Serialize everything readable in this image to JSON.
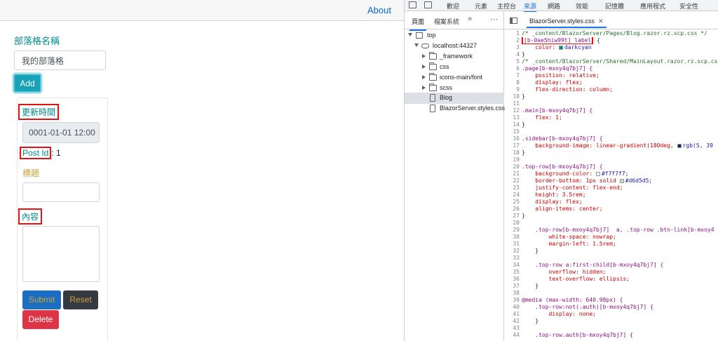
{
  "app": {
    "top_link": "About",
    "blog_name_label": "部落格名稱",
    "blog_name_value": "我的部落格",
    "add_label": "Add",
    "updated_label": "更新時間",
    "updated_value": "0001-01-01 12:00",
    "post_id_label": "Post Id",
    "post_id_value": ": 1",
    "title_label": "標題",
    "content_label": "內容",
    "submit_label": "Submit",
    "reset_label": "Reset",
    "delete_label": "Delete"
  },
  "devtools": {
    "tabs": [
      "歡迎",
      "元素",
      "主控台",
      "來源",
      "網路",
      "效能",
      "記憶體",
      "應用程式",
      "安全性"
    ],
    "active_tab": "來源",
    "nav_tabs": [
      "頁面",
      "檔案系統"
    ],
    "nav_more": "»",
    "nav_menu": "⋯",
    "tree": [
      {
        "label": "top",
        "icon": "frame-icon",
        "expanded": true
      },
      {
        "label": "localhost:44327",
        "icon": "cloud-icon",
        "expanded": true
      },
      {
        "label": "_framework",
        "icon": "folder-icon",
        "expanded": false
      },
      {
        "label": "css",
        "icon": "folder-icon",
        "expanded": false
      },
      {
        "label": "icons-main/font",
        "icon": "folder-icon",
        "expanded": false
      },
      {
        "label": "scss",
        "icon": "folder-icon",
        "expanded": false
      },
      {
        "label": "Blog",
        "icon": "file-icon",
        "selected": true
      },
      {
        "label": "BlazorServer.styles.css",
        "icon": "file-icon"
      }
    ],
    "open_file": "BlazorServer.styles.css",
    "code": [
      {
        "n": "1",
        "t": "/* _content/BlazorServer/Pages/Blog.razor.rz.scp.css */",
        "k": "cm"
      },
      {
        "n": "2",
        "t": "[b-0ae5hiw99t] label",
        "k": "sel",
        "suffix": " {",
        "hl": true
      },
      {
        "n": "3",
        "t": "    color: ",
        "k": "prop",
        "value": "darkcyan",
        "swatch": "#008b8b"
      },
      {
        "n": "4",
        "t": "}",
        "k": "tx"
      },
      {
        "n": "5",
        "t": "/* _content/BlazorServer/Shared/MainLayout.razor.rz.scp.css */",
        "k": "cm"
      },
      {
        "n": "6",
        "t": ".page[b-mxoy4q7bj7] {",
        "k": "sel"
      },
      {
        "n": "7",
        "t": "    position: relative;",
        "k": "prop"
      },
      {
        "n": "8",
        "t": "    display: flex;",
        "k": "prop"
      },
      {
        "n": "9",
        "t": "    flex-direction: column;",
        "k": "prop"
      },
      {
        "n": "10",
        "t": "}",
        "k": "tx"
      },
      {
        "n": "11",
        "t": "",
        "k": "tx"
      },
      {
        "n": "12",
        "t": ".main[b-mxoy4q7bj7] {",
        "k": "sel"
      },
      {
        "n": "13",
        "t": "    flex: 1;",
        "k": "prop"
      },
      {
        "n": "14",
        "t": "}",
        "k": "tx"
      },
      {
        "n": "15",
        "t": "",
        "k": "tx"
      },
      {
        "n": "16",
        "t": ".sidebar[b-mxoy4q7bj7] {",
        "k": "sel"
      },
      {
        "n": "17",
        "t": "    background-image: linear-gradient(180deg, ",
        "k": "prop",
        "value": "rgb(5, 39",
        "swatch": "#052767"
      },
      {
        "n": "18",
        "t": "}",
        "k": "tx"
      },
      {
        "n": "19",
        "t": "",
        "k": "tx"
      },
      {
        "n": "20",
        "t": ".top-row[b-mxoy4q7bj7] {",
        "k": "sel"
      },
      {
        "n": "21",
        "t": "    background-color: ",
        "k": "prop",
        "value": "#f7f7f7;",
        "swatch": "#f7f7f7"
      },
      {
        "n": "22",
        "t": "    border-bottom: 1px solid ",
        "k": "prop",
        "value": "#d6d5d5;",
        "swatch": "#d6d5d5"
      },
      {
        "n": "23",
        "t": "    justify-content: flex-end;",
        "k": "prop"
      },
      {
        "n": "24",
        "t": "    height: 3.5rem;",
        "k": "prop"
      },
      {
        "n": "25",
        "t": "    display: flex;",
        "k": "prop"
      },
      {
        "n": "26",
        "t": "    align-items: center;",
        "k": "prop"
      },
      {
        "n": "27",
        "t": "}",
        "k": "tx"
      },
      {
        "n": "28",
        "t": "",
        "k": "tx"
      },
      {
        "n": "29",
        "t": "    .top-row[b-mxoy4q7bj7]  a, .top-row .btn-link[b-mxoy4",
        "k": "sel"
      },
      {
        "n": "30",
        "t": "        white-space: nowrap;",
        "k": "prop"
      },
      {
        "n": "31",
        "t": "        margin-left: 1.5rem;",
        "k": "prop"
      },
      {
        "n": "32",
        "t": "    }",
        "k": "tx"
      },
      {
        "n": "33",
        "t": "",
        "k": "tx"
      },
      {
        "n": "34",
        "t": "    .top-row a:first-child[b-mxoy4q7bj7] {",
        "k": "sel"
      },
      {
        "n": "35",
        "t": "        overflow: hidden;",
        "k": "prop"
      },
      {
        "n": "36",
        "t": "        text-overflow: ellipsis;",
        "k": "prop"
      },
      {
        "n": "37",
        "t": "    }",
        "k": "tx"
      },
      {
        "n": "38",
        "t": "",
        "k": "tx"
      },
      {
        "n": "39",
        "t": "@media (max-width: 640.98px) {",
        "k": "at"
      },
      {
        "n": "40",
        "t": "    .top-row:not(.auth)[b-mxoy4q7bj7] {",
        "k": "sel"
      },
      {
        "n": "41",
        "t": "        display: none;",
        "k": "prop"
      },
      {
        "n": "42",
        "t": "    }",
        "k": "tx"
      },
      {
        "n": "43",
        "t": "",
        "k": "tx"
      },
      {
        "n": "44",
        "t": "    .top-row.auth[b-mxoy4q7bj7] {",
        "k": "sel"
      }
    ]
  }
}
